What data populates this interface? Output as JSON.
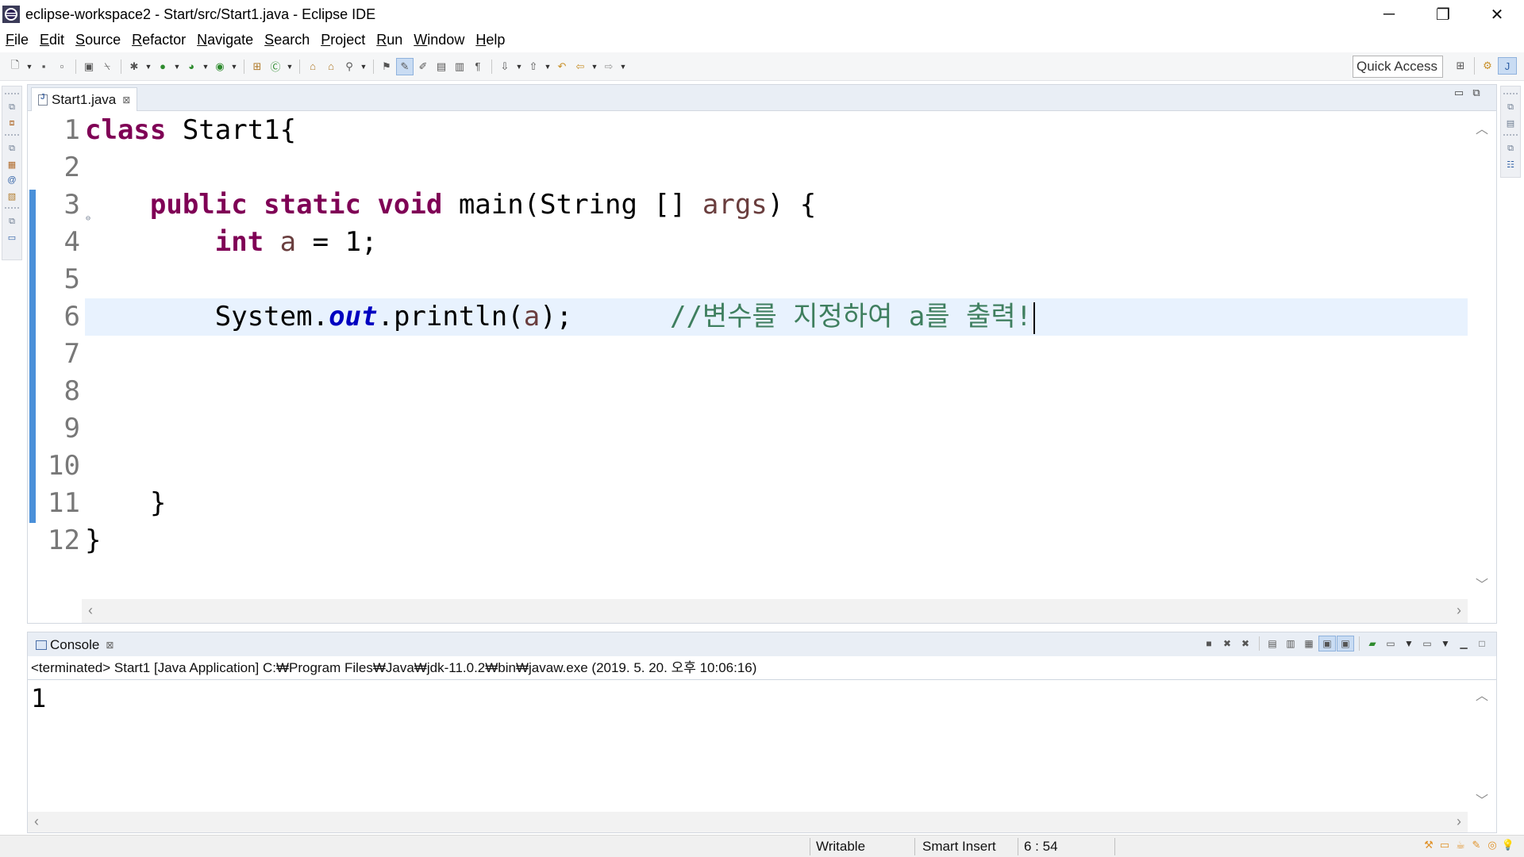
{
  "window": {
    "title": "eclipse-workspace2 - Start/src/Start1.java - Eclipse IDE",
    "minimize_glyph": "─",
    "restore_glyph": "❐",
    "close_glyph": "✕"
  },
  "menu": [
    "File",
    "Edit",
    "Source",
    "Refactor",
    "Navigate",
    "Search",
    "Project",
    "Run",
    "Window",
    "Help"
  ],
  "toolbar": {
    "quick_access": "Quick Access"
  },
  "editor": {
    "tab_label": "Start1.java",
    "tab_close": "⊠",
    "line_numbers": [
      "1",
      "2",
      "3",
      "4",
      "5",
      "6",
      "7",
      "8",
      "9",
      "10",
      "11",
      "12"
    ],
    "code": {
      "l1_kw": "class",
      "l1_rest": " Start1{",
      "l3_indent": "    ",
      "l3_kw": "public static void",
      "l3_mid": " main(String [] ",
      "l3_var": "args",
      "l3_end": ") {",
      "l4_indent": "        ",
      "l4_kw": "int",
      "l4_sp": " ",
      "l4_var": "a",
      "l4_end": " = 1;",
      "l6_indent": "        ",
      "l6_sys": "System.",
      "l6_field": "out",
      "l6_call": ".println(",
      "l6_var": "a",
      "l6_end": ");",
      "l6_gap": "      ",
      "l6_comment": "//변수를 지정하여 a를 출력!",
      "l11": "    }",
      "l12": "}"
    },
    "current_line": 6
  },
  "console": {
    "tab_label": "Console",
    "tab_close": "⊠",
    "description": "<terminated> Start1 [Java Application] C:₩Program Files₩Java₩jdk-11.0.2₩bin₩javaw.exe (2019. 5. 20. 오후 10:06:16)",
    "output": "1"
  },
  "status": {
    "writable": "Writable",
    "insert_mode": "Smart Insert",
    "position": "6 : 54"
  },
  "colors": {
    "keyword": "#7f0055",
    "variable": "#6a3e3e",
    "field": "#0000c0",
    "comment": "#3f7f5f",
    "current_line": "#e8f2fe"
  }
}
